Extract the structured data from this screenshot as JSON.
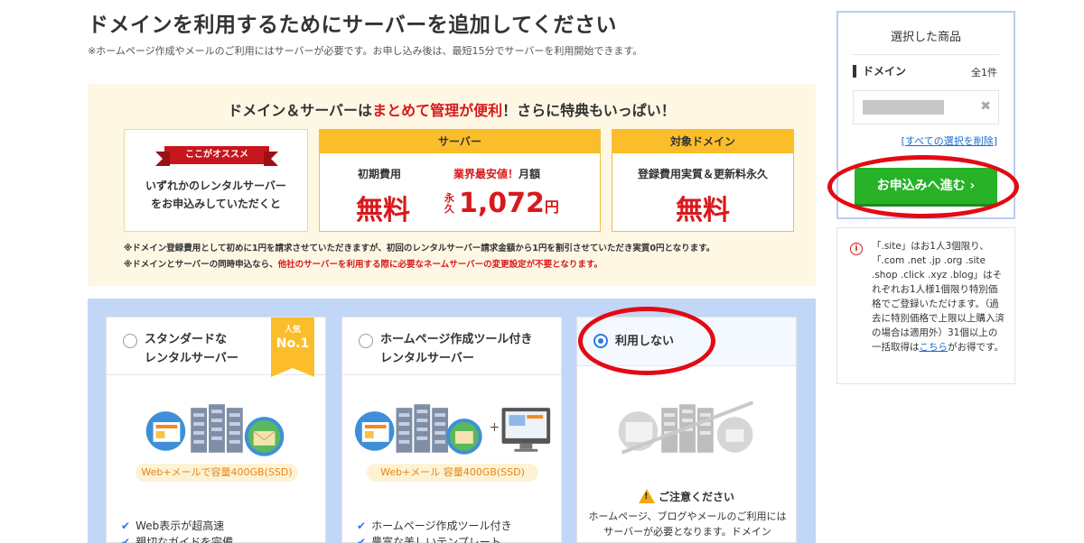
{
  "page": {
    "title": "ドメインを利用するためにサーバーを追加してください",
    "subtitle": "※ホームページ作成やメールのご利用にはサーバーが必要です。お申し込み後は、最短15分でサーバーを利用開始できます。"
  },
  "promo": {
    "headline_pre": "ドメイン＆サーバーは",
    "headline_highlight": "まとめて管理が便利",
    "headline_post": "！さらに特典もいっぱい！",
    "recommend_ribbon": "ここがオススメ",
    "recommend_line1": "いずれかのレンタルサーバー",
    "recommend_line2": "をお申込みしていただくと",
    "server_header": "サーバー",
    "server_initial_label": "初期費用",
    "server_initial_value": "無料",
    "server_monthly_highlight": "業界最安値！",
    "server_monthly_label": "月額",
    "server_eikyu": "永久",
    "server_monthly_value": "1,072",
    "server_monthly_unit": "円",
    "domain_header": "対象ドメイン",
    "domain_label": "登録費用実質＆更新料永久",
    "domain_value": "無料",
    "note1": "※ドメイン登録費用として初めに1円を請求させていただきますが、初回のレンタルサーバー請求金額から1円を割引させていただき実質0円となります。",
    "note2_pre": "※ドメインとサーバーの同時申込なら、",
    "note2_highlight": "他社のサーバーを利用する際に必要なネームサーバーの変更設定が不要となります。"
  },
  "plans": [
    {
      "title_line1": "スタンダードな",
      "title_line2": "レンタルサーバー",
      "badge_top": "人気",
      "badge_main": "No.1",
      "storage": "Web+メールで容量400GB(SSD)",
      "features": [
        "Web表示が超高速",
        "親切なガイドを完備"
      ]
    },
    {
      "title_line1": "ホームページ作成ツール付き",
      "title_line2": "レンタルサーバー",
      "storage": "Web+メール 容量400GB(SSD)",
      "features": [
        "ホームページ作成ツール付き",
        "豊富な美しいテンプレート"
      ]
    },
    {
      "title_line1": "利用しない",
      "warning_title": "ご注意ください",
      "warning_body": "ホームページ、ブログやメールのご利用にはサーバーが必要となります。ドメイン"
    }
  ],
  "sidebar": {
    "title": "選択した商品",
    "domain_label": "ドメイン",
    "count": "全1件",
    "clear_bracket_open": "[",
    "clear_link": "すべての選択を削除",
    "clear_bracket_close": "]",
    "proceed_button": "お申込みへ進む ›"
  },
  "info": {
    "text_before_link": "「.site」はお1人3個限り、「.com .net .jp .org .site .shop .click .xyz .blog」はそれぞれお1人様1個限り特別価格でご登録いただけます。（過去に特別価格で上限以上購入済の場合は適用外）31個以上の一括取得は",
    "link": "こちら",
    "text_after_link": "がお得です。"
  },
  "colors": {
    "accent_red": "#d8191c",
    "header_yellow": "#fbbe2a",
    "plan_area_blue": "#c2d6f7",
    "button_green": "#27b227",
    "annotation_red": "#e30a14"
  }
}
